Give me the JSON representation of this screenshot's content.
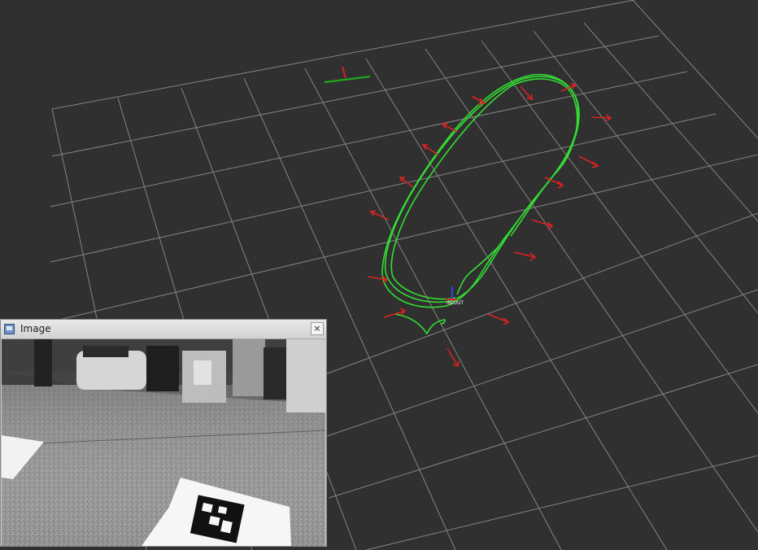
{
  "image_window": {
    "title": "Image",
    "close_symbol": "×",
    "icon": "image-window-icon"
  },
  "viewport": {
    "background": "#303030",
    "grid_color": "#a0a0a0",
    "trajectory_color": "#33dd33",
    "arrow_color": "#dd2222",
    "marker_label": "IN/OUT"
  }
}
